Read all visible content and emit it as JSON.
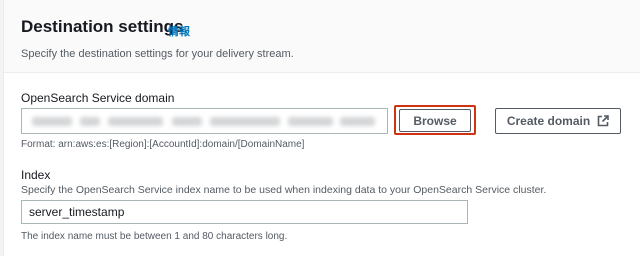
{
  "section": {
    "title": "Destination settings",
    "info_link": "情報",
    "description": "Specify the destination settings for your delivery stream."
  },
  "domain": {
    "label": "OpenSearch Service domain",
    "browse_label": "Browse",
    "create_label": "Create domain",
    "create_icon": "external-link-icon",
    "format_hint": "Format: arn:aws:es:[Region]:[AccountId]:domain/[DomainName]"
  },
  "index": {
    "label": "Index",
    "description": "Specify the OpenSearch Service index name to be used when indexing data to your OpenSearch Service cluster.",
    "value": "server_timestamp",
    "constraint": "The index name must be between 1 and 80 characters long."
  },
  "colors": {
    "link": "#0073bb",
    "highlight": "#d13212",
    "text": "#16191f",
    "secondary_text": "#545b64"
  }
}
